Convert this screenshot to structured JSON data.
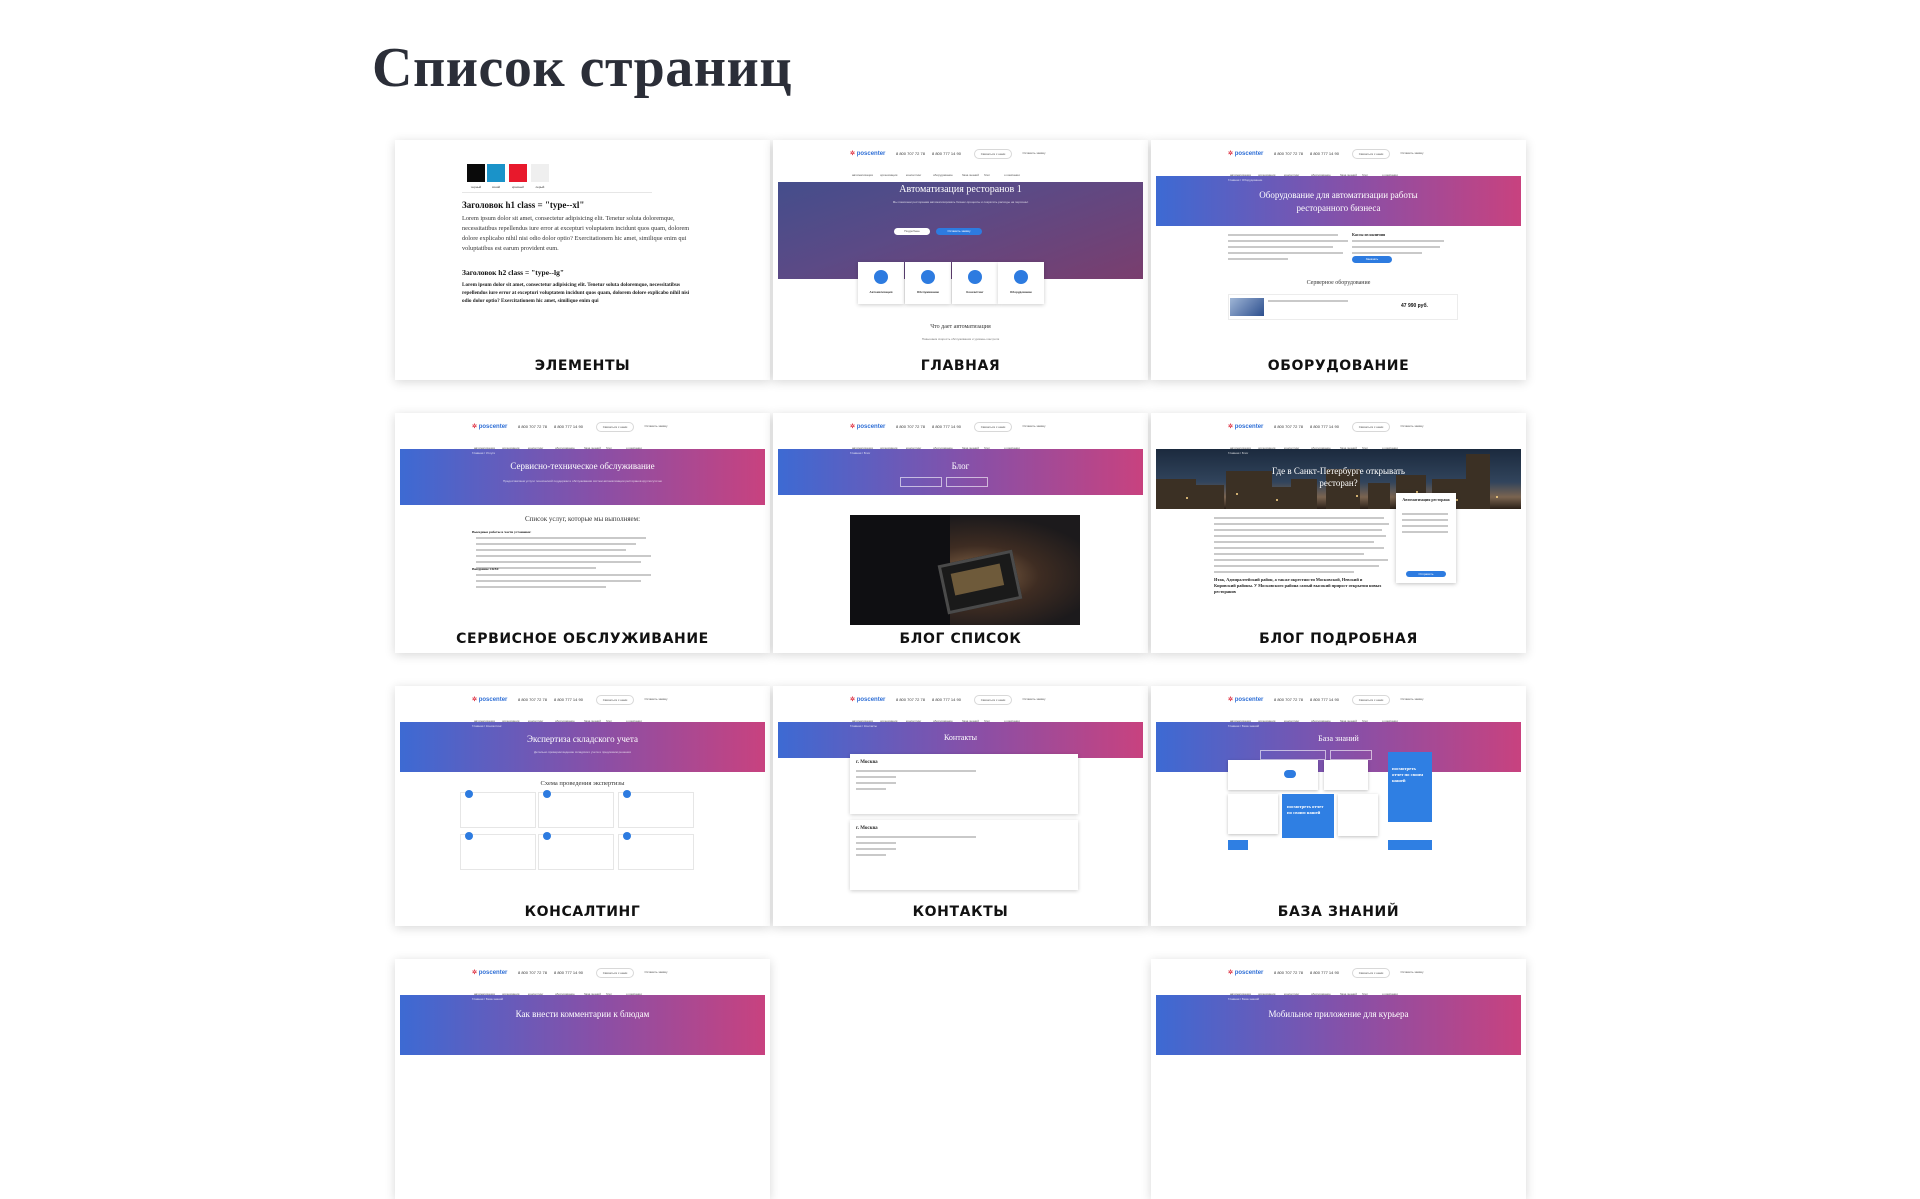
{
  "page": {
    "title": "Список страниц"
  },
  "colors": {
    "accent_blue": "#2d7be0",
    "gradient_start": "#3d6ad3",
    "gradient_end": "#c8427f",
    "label": "#111111"
  },
  "mini": {
    "logo": "poscenter",
    "phone1": "8 800 707 72 78",
    "phone2": "8 800 777 14 90",
    "cta": "Связаться с нами",
    "cta2": "Оставить заявку",
    "nav": [
      "автоматизация",
      "организация",
      "консалтинг",
      "оборудование",
      "база знаний",
      "блог",
      "о компании"
    ]
  },
  "cards": [
    {
      "label": "ЭЛЕМЕНТЫ",
      "swatch_caps": [
        "черный",
        "синий",
        "красный",
        "серый"
      ],
      "h1": "Заголовок h1 class = \"type--xl\"",
      "p1": "Lorem ipsum dolor sit amet, consectetur adipisicing elit. Tenetur soluta doloremque, necessitatibus repellendus iure error at excepturi voluptatem incidunt quos quam, dolorem dolore explicabo nihil nisi odio dolor optio? Exercitationem hic amet, similique enim qui voluptatibus est earum provident eum.",
      "h2": "Заголовок h2 class = \"type--lg\"",
      "p2": "Lorem ipsum dolor sit amet, consectetur adipisicing elit. Tenetur soluta doloremque, necessitatibus repellendus iure error at excepturi voluptatem incidunt quos quam, dolorem dolore explicabo nihil nisi odio dolor optio? Exercitationem hic amet, similique enim qui"
    },
    {
      "label": "ГЛАВНАЯ",
      "hero": "Автоматизация ресторанов 1",
      "features": [
        "Автоматизация",
        "Обслуживание",
        "Консалтинг",
        "Оборудование"
      ],
      "section": "Что дает автоматизация"
    },
    {
      "label": "ОБОРУДОВАНИЕ",
      "hero": "Оборудование для автоматизации работы ресторанного бизнеса",
      "section": "Серверное оборудование",
      "price": "47 990 руб."
    },
    {
      "label": "СЕРВИСНОЕ ОБСЛУЖИВАНИЕ",
      "hero": "Сервисно-техническое обслуживание",
      "section": "Список услуг, которые мы выполняем:"
    },
    {
      "label": "БЛОГ СПИСОК",
      "hero": "Блог"
    },
    {
      "label": "БЛОГ ПОДРОБНАЯ",
      "hero": "Где в Санкт-Петербурге открывать ресторан?",
      "form_title": "Автоматизация ресторана"
    },
    {
      "label": "КОНСАЛТИНГ",
      "hero": "Экспертиза складского учета",
      "section": "Схема проведения экспертизы"
    },
    {
      "label": "КОНТАКТЫ",
      "hero": "Контакты",
      "city1": "г. Москва",
      "city2": "г. Москва"
    },
    {
      "label": "БАЗА ЗНАНИЙ",
      "hero": "База знаний",
      "promo": "посмотреть отчет по своим нашей"
    },
    {
      "hero": "Как внести комментарии к блюдам"
    },
    {
      "empty": true
    },
    {
      "hero": "Мобильное приложение для курьера"
    }
  ]
}
